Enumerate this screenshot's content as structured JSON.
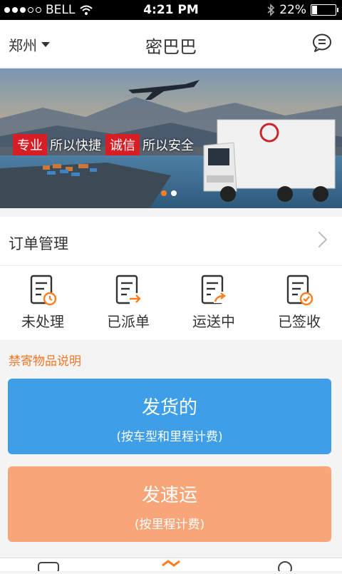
{
  "status_bar": {
    "carrier": "BELL",
    "time": "4:21 PM",
    "battery": "22%",
    "battery_level": 0.22
  },
  "nav": {
    "city": "郑州",
    "title": "密巴巴",
    "message_icon": "chat-bubble-icon"
  },
  "banner": {
    "slogans": [
      {
        "tag": "专业",
        "text": "所以快捷"
      },
      {
        "tag": "诚信",
        "text": "所以安全"
      }
    ],
    "page_count": 2,
    "active_page": 1
  },
  "orders": {
    "title": "订单管理",
    "statuses": [
      {
        "label": "未处理",
        "icon": "order-pending-icon"
      },
      {
        "label": "已派单",
        "icon": "order-dispatched-icon"
      },
      {
        "label": "运送中",
        "icon": "order-shipping-icon"
      },
      {
        "label": "已签收",
        "icon": "order-received-icon"
      }
    ]
  },
  "notice": "禁寄物品说明",
  "actions": {
    "ship": {
      "title": "发货的",
      "subtitle": "(按车型和里程计费)",
      "color": "#3e9ee8"
    },
    "express": {
      "title": "发速运",
      "subtitle": "(按里程计费)",
      "color": "#f8a57a"
    }
  },
  "accent_color": "#ff7e1f"
}
